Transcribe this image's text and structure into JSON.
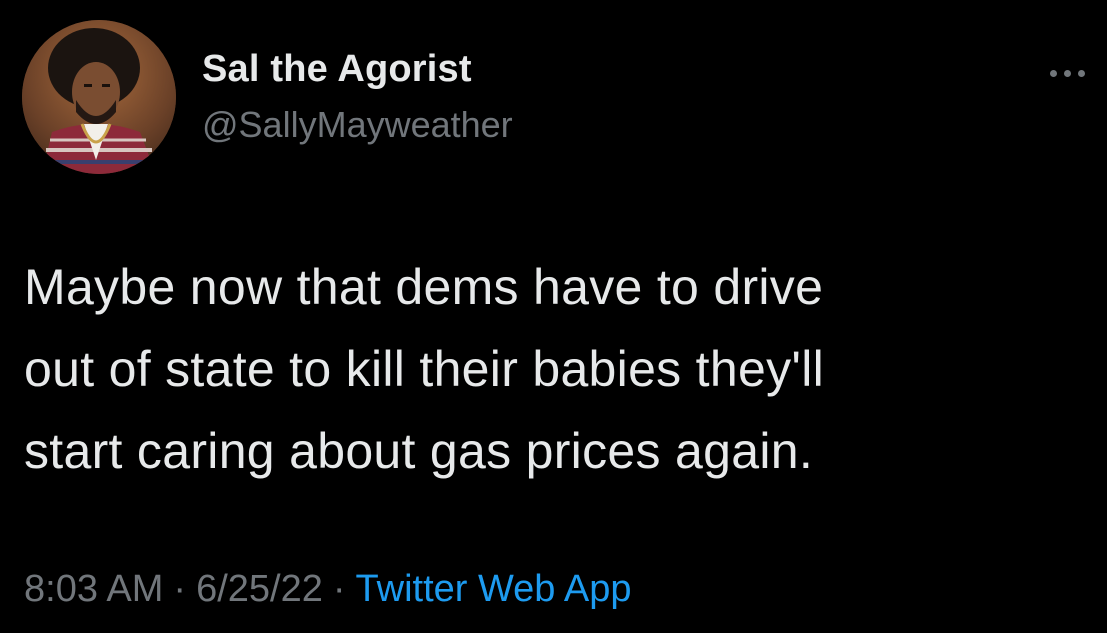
{
  "tweet": {
    "author": {
      "display_name": "Sal the Agorist",
      "handle": "@SallyMayweather",
      "avatar_icon": "profile-photo"
    },
    "menu_icon": "more-options-icon",
    "text_lines": [
      "Maybe now that dems have to drive",
      "out of state to kill their babies they'll",
      "start caring about gas prices again."
    ],
    "meta": {
      "time": "8:03 AM",
      "separator": "·",
      "date": "6/25/22",
      "source": "Twitter Web App"
    }
  },
  "colors": {
    "background": "#000000",
    "primary_text": "#e7e9ea",
    "secondary_text": "#71767b",
    "link": "#1d9bf0"
  }
}
